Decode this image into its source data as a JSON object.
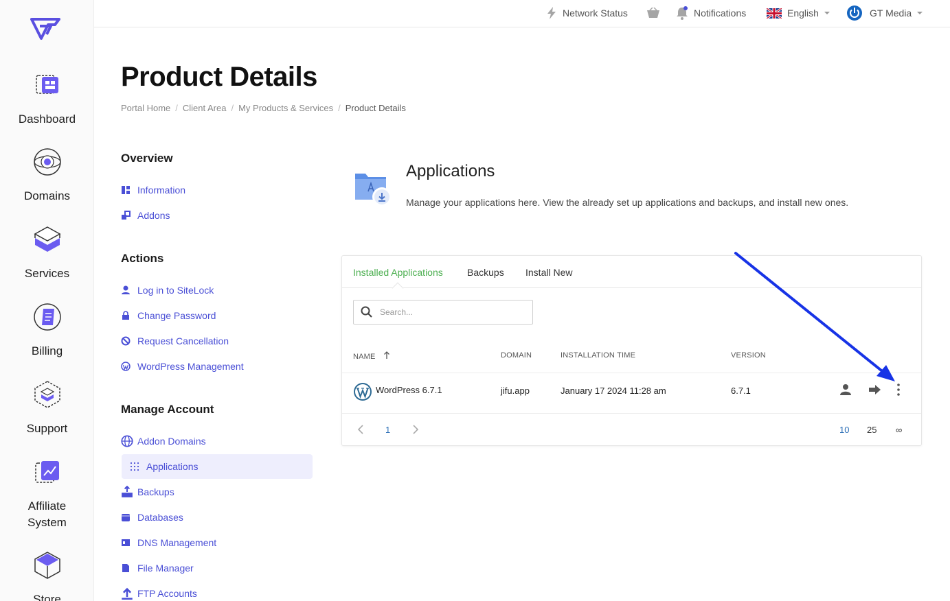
{
  "rail": {
    "items": [
      {
        "label": "Dashboard"
      },
      {
        "label": "Domains"
      },
      {
        "label": "Services"
      },
      {
        "label": "Billing"
      },
      {
        "label": "Support"
      },
      {
        "label": "Affiliate System"
      },
      {
        "label": "Store"
      }
    ]
  },
  "topbar": {
    "network_status": "Network Status",
    "notifications": "Notifications",
    "language": "English",
    "account": "GT Media"
  },
  "page": {
    "title": "Product Details",
    "breadcrumb": [
      "Portal Home",
      "Client Area",
      "My Products & Services",
      "Product Details"
    ]
  },
  "sidebar": {
    "overview": {
      "heading": "Overview",
      "items": [
        {
          "label": "Information"
        },
        {
          "label": "Addons"
        }
      ]
    },
    "actions": {
      "heading": "Actions",
      "items": [
        {
          "label": "Log in to SiteLock"
        },
        {
          "label": "Change Password"
        },
        {
          "label": "Request Cancellation"
        },
        {
          "label": "WordPress Management"
        }
      ]
    },
    "manage": {
      "heading": "Manage Account",
      "items": [
        {
          "label": "Addon Domains"
        },
        {
          "label": "Applications"
        },
        {
          "label": "Backups"
        },
        {
          "label": "Databases"
        },
        {
          "label": "DNS Management"
        },
        {
          "label": "File Manager"
        },
        {
          "label": "FTP Accounts"
        }
      ]
    }
  },
  "applications": {
    "title": "Applications",
    "description": "Manage your applications here. View the already set up applications and backups, and install new ones.",
    "tabs": [
      {
        "label": "Installed Applications",
        "active": true
      },
      {
        "label": "Backups"
      },
      {
        "label": "Install New"
      }
    ],
    "search_placeholder": "Search...",
    "columns": {
      "name": "NAME",
      "domain": "DOMAIN",
      "installation_time": "INSTALLATION TIME",
      "version": "VERSION"
    },
    "rows": [
      {
        "name": "WordPress 6.7.1",
        "domain": "jifu.app",
        "installation_time": "January 17 2024 11:28 am",
        "version": "6.7.1"
      }
    ],
    "pagination": {
      "current_page": "1",
      "page_sizes": [
        "10",
        "25",
        "∞"
      ],
      "selected_size": "10"
    }
  },
  "colors": {
    "accent": "#4a4fd6",
    "active_tab": "#4caf50",
    "annotation_arrow": "#1733e6"
  }
}
